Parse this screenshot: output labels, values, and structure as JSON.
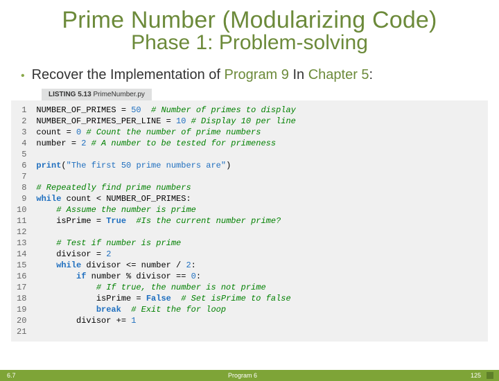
{
  "title": "Prime Number (Modularizing Code)",
  "subtitle": "Phase 1: Problem-solving",
  "bullet": {
    "pre": "Recover the Implementation of ",
    "prog": "Program 9",
    "mid": " In ",
    "chap": "Chapter 5",
    "post": ":"
  },
  "listing": {
    "bold": "LISTING 5.13",
    "rest": " PrimeNumber.py"
  },
  "linenumbers": "1\n2\n3\n4\n5\n6\n7\n8\n9\n10\n11\n12\n13\n14\n15\n16\n17\n18\n19\n20\n21",
  "code": {
    "l1a": "NUMBER_OF_PRIMES = ",
    "l1n": "50",
    "l1c": "  # Number of primes to display",
    "l2a": "NUMBER_OF_PRIMES_PER_LINE = ",
    "l2n": "10",
    "l2c": " # Display 10 per line",
    "l3a": "count = ",
    "l3n": "0",
    "l3c": " # Count the number of prime numbers",
    "l4a": "number = ",
    "l4n": "2",
    "l4c": " # A number to be tested for primeness",
    "l6k": "print",
    "l6p": "(",
    "l6s": "\"The first 50 prime numbers are\"",
    "l6q": ")",
    "l8c": "# Repeatedly find prime numbers",
    "l9k": "while",
    "l9r": " count < NUMBER_OF_PRIMES:",
    "l10c": "    # Assume the number is prime",
    "l11a": "    isPrime = ",
    "l11b": "True",
    "l11c": "  #Is the current number prime?",
    "l13c": "    # Test if number is prime",
    "l14a": "    divisor = ",
    "l14n": "2",
    "l15i": "    ",
    "l15k": "while",
    "l15r": " divisor <= number / ",
    "l15n": "2",
    "l15e": ":",
    "l16i": "        ",
    "l16k": "if",
    "l16r": " number % divisor == ",
    "l16n": "0",
    "l16e": ":",
    "l17c": "            # If true, the number is not prime",
    "l18a": "            isPrime = ",
    "l18b": "False",
    "l18c": "  # Set isPrime to false",
    "l19i": "            ",
    "l19k": "break",
    "l19c": "  # Exit the for loop",
    "l20a": "        divisor += ",
    "l20n": "1"
  },
  "footer": {
    "left": "6.7",
    "center": "Program 6",
    "right": "125"
  }
}
